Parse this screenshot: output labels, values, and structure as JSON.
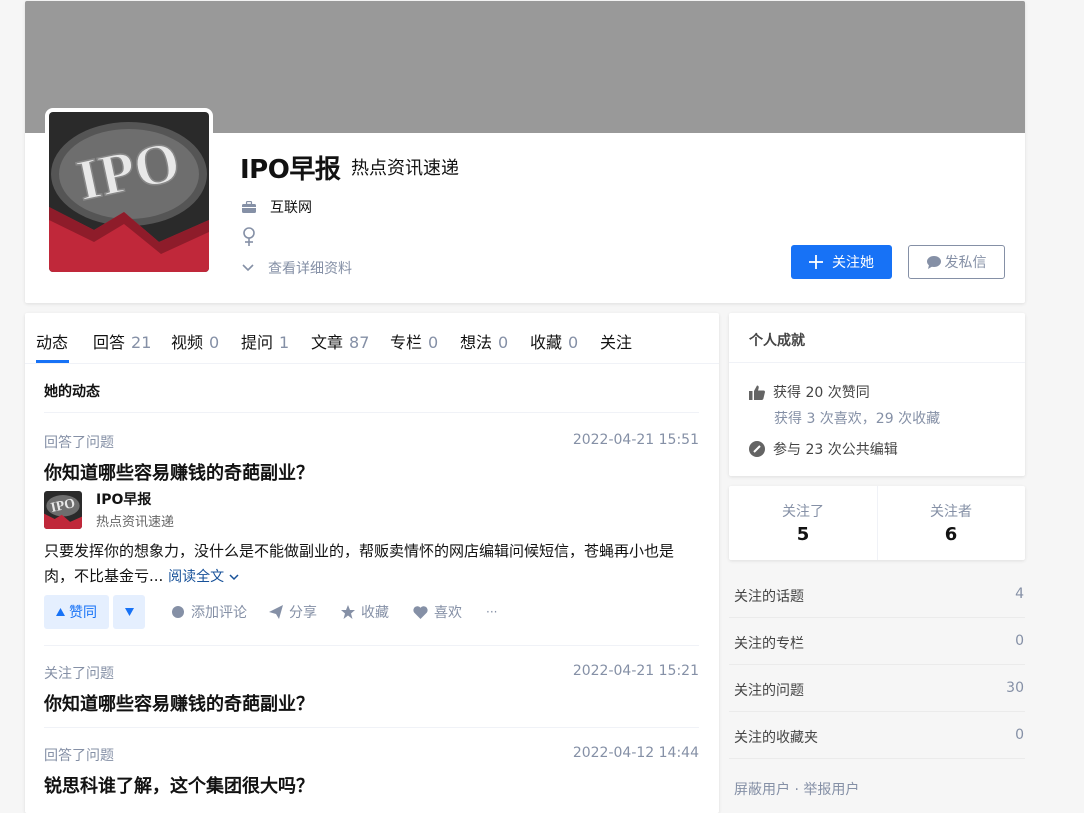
{
  "profile": {
    "name": "IPO早报",
    "headline": "热点资讯速递",
    "industry": "互联网",
    "gender_icon": "female-icon",
    "more_info": "查看详细资料",
    "avatar_text": "IPO",
    "follow_label": "关注她",
    "message_label": "发私信",
    "cover_color": "#999999",
    "accent_color": "#1772f6"
  },
  "tabs": [
    {
      "label": "动态",
      "count": ""
    },
    {
      "label": "回答",
      "count": "21"
    },
    {
      "label": "视频",
      "count": "0"
    },
    {
      "label": "提问",
      "count": "1"
    },
    {
      "label": "文章",
      "count": "87"
    },
    {
      "label": "专栏",
      "count": "0"
    },
    {
      "label": "想法",
      "count": "0"
    },
    {
      "label": "收藏",
      "count": "0"
    },
    {
      "label": "关注",
      "count": ""
    }
  ],
  "feed": {
    "title": "她的动态",
    "items": [
      {
        "action": "回答了问题",
        "time": "2022-04-21 15:51",
        "question": "你知道哪些容易赚钱的奇葩副业？",
        "author_name": "IPO早报",
        "author_headline": "热点资讯速递",
        "excerpt": "只要发挥你的想象力，没什么是不能做副业的，帮贩卖情怀的网店编辑问候短信，苍蝇再小也是肉，不比基金亏...",
        "read_more": "阅读全文",
        "vote_label": "赞同",
        "comment": "添加评论",
        "share": "分享",
        "collect": "收藏",
        "like": "喜欢",
        "more": "···"
      },
      {
        "action": "关注了问题",
        "time": "2022-04-21 15:21",
        "question": "你知道哪些容易赚钱的奇葩副业？"
      },
      {
        "action": "回答了问题",
        "time": "2022-04-12 14:44",
        "question": "锐思科谁了解，这个集团很大吗？"
      }
    ]
  },
  "achievements": {
    "title": "个人成就",
    "likes": "获得 20 次赞同",
    "likes_sub": "获得 3 次喜欢，29 次收藏",
    "edits": "参与 23 次公共编辑"
  },
  "follow": {
    "following_label": "关注了",
    "following": "5",
    "followers_label": "关注者",
    "followers": "6"
  },
  "side_list": [
    {
      "label": "关注的话题",
      "value": "4"
    },
    {
      "label": "关注的专栏",
      "value": "0"
    },
    {
      "label": "关注的问题",
      "value": "30"
    },
    {
      "label": "关注的收藏夹",
      "value": "0"
    }
  ],
  "footer": "屏蔽用户 · 举报用户"
}
